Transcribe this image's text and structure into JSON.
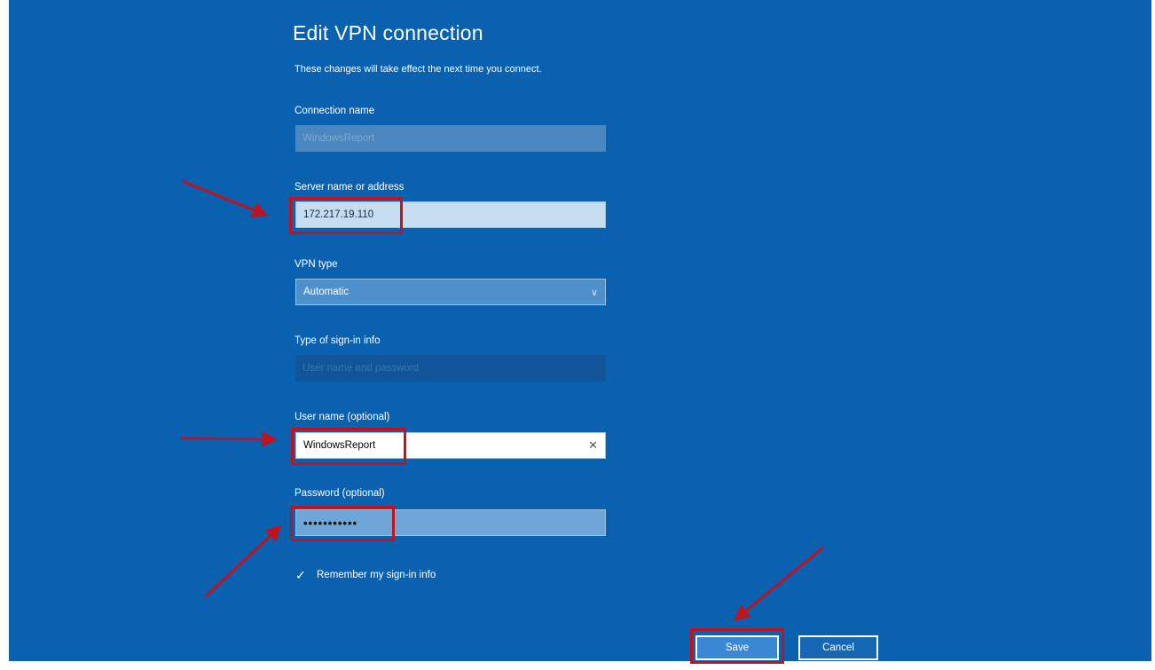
{
  "dialog": {
    "title": "Edit VPN connection",
    "subtitle": "These changes will take effect the next time you connect."
  },
  "fields": {
    "connection_name": {
      "label": "Connection name",
      "value": "WindowsReport"
    },
    "server": {
      "label": "Server name or address",
      "value": "172.217.19.110"
    },
    "vpn_type": {
      "label": "VPN type",
      "value": "Automatic"
    },
    "sign_in_type": {
      "label": "Type of sign-in info",
      "value": "User name and password"
    },
    "username": {
      "label": "User name (optional)",
      "value": "WindowsReport"
    },
    "password": {
      "label": "Password (optional)",
      "value": "•••••••••••"
    }
  },
  "remember": {
    "label": "Remember my sign-in info",
    "checked": true
  },
  "buttons": {
    "save": "Save",
    "cancel": "Cancel"
  },
  "icons": {
    "vpn_type_dropdown": "chevron-down-icon",
    "clear_username": "close-icon",
    "remember_check": "check-icon"
  },
  "colors": {
    "background": "#0a61b0",
    "annotation": "#c0121f"
  }
}
